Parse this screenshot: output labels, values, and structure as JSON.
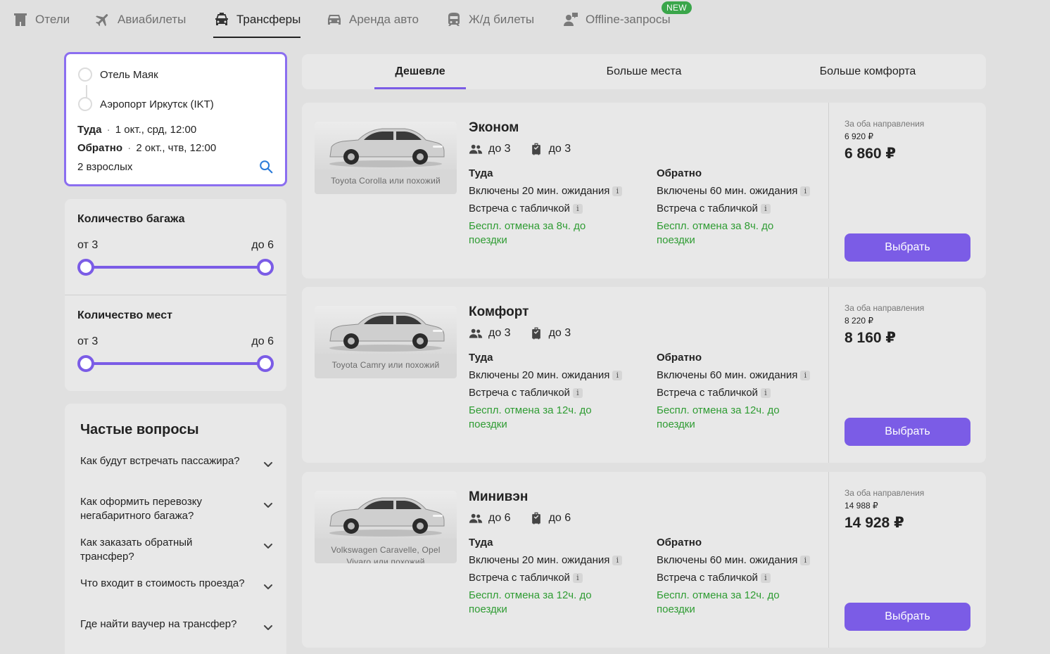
{
  "nav": {
    "tabs": [
      {
        "label": "Отели",
        "icon": "hotel-icon"
      },
      {
        "label": "Авиабилеты",
        "icon": "plane-icon"
      },
      {
        "label": "Трансферы",
        "icon": "car-front-icon",
        "active": true
      },
      {
        "label": "Аренда авто",
        "icon": "car-rent-icon"
      },
      {
        "label": "Ж/д билеты",
        "icon": "train-icon"
      },
      {
        "label": "Offline-запросы",
        "icon": "person-chat-icon"
      }
    ],
    "new_badge": "NEW"
  },
  "search": {
    "from": "Отель Маяк",
    "to": "Аэропорт Иркутск (IKT)",
    "there_label": "Туда",
    "there_value": "1 окт., срд, 12:00",
    "back_label": "Обратно",
    "back_value": "2 окт., чтв, 12:00",
    "passengers": "2 взрослых",
    "separator": "·"
  },
  "filters": {
    "luggage": {
      "title": "Количество багажа",
      "from": "от 3",
      "to": "до 6"
    },
    "seats": {
      "title": "Количество мест",
      "from": "от 3",
      "to": "до 6"
    }
  },
  "faq": {
    "title": "Частые вопросы",
    "items": [
      "Как будут встречать пассажира?",
      "Как оформить перевозку негабаритного багажа?",
      "Как заказать обратный трансфер?",
      "Что входит в стоимость проезда?",
      "Где найти ваучер на трансфер?"
    ]
  },
  "categories": {
    "tabs": [
      "Дешевле",
      "Больше места",
      "Больше комфорта"
    ],
    "active_index": 0
  },
  "offers": [
    {
      "name": "Эконом",
      "car": "Toyota Corolla или похожий",
      "passengers": "до 3",
      "luggage": "до 3",
      "there": {
        "label": "Туда",
        "wait": "Включены 20 мин. ожидания",
        "sign": "Встреча с табличкой",
        "cancel": "Беспл. отмена за 8ч. до поездки"
      },
      "back": {
        "label": "Обратно",
        "wait": "Включены 60 мин. ожидания",
        "sign": "Встреча с табличкой",
        "cancel": "Беспл. отмена за 8ч. до поездки"
      },
      "both_label": "За оба направления",
      "old_price": "6 920 ₽",
      "price": "6 860 ₽",
      "button": "Выбрать"
    },
    {
      "name": "Комфорт",
      "car": "Toyota Camry или похожий",
      "passengers": "до 3",
      "luggage": "до 3",
      "there": {
        "label": "Туда",
        "wait": "Включены 20 мин. ожидания",
        "sign": "Встреча с табличкой",
        "cancel": "Беспл. отмена за 12ч. до поездки"
      },
      "back": {
        "label": "Обратно",
        "wait": "Включены 60 мин. ожидания",
        "sign": "Встреча с табличкой",
        "cancel": "Беспл. отмена за 12ч. до поездки"
      },
      "both_label": "За оба направления",
      "old_price": "8 220 ₽",
      "price": "8 160 ₽",
      "button": "Выбрать"
    },
    {
      "name": "Минивэн",
      "car": "Volkswagen Caravelle, Opel Vivaro или похожий",
      "passengers": "до 6",
      "luggage": "до 6",
      "there": {
        "label": "Туда",
        "wait": "Включены 20 мин. ожидания",
        "sign": "Встреча с табличкой",
        "cancel": "Беспл. отмена за 12ч. до поездки"
      },
      "back": {
        "label": "Обратно",
        "wait": "Включены 60 мин. ожидания",
        "sign": "Встреча с табличкой",
        "cancel": "Беспл. отмена за 12ч. до поездки"
      },
      "both_label": "За оба направления",
      "old_price": "14 988 ₽",
      "price": "14 928 ₽",
      "button": "Выбрать"
    }
  ],
  "info_glyph": "i",
  "colors": {
    "accent": "#7b5ce6",
    "green": "#2f9c33",
    "badge": "#3aa64a",
    "background": "#e0e0e0"
  }
}
